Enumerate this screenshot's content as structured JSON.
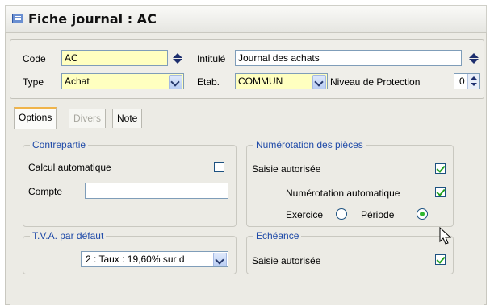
{
  "window": {
    "title": "Fiche journal : AC"
  },
  "header": {
    "code_label": "Code",
    "code_value": "AC",
    "intitule_label": "Intitulé",
    "intitule_value": "Journal des achats",
    "type_label": "Type",
    "type_value": "Achat",
    "etab_label": "Etab.",
    "etab_value": "COMMUN",
    "niveau_label": "Niveau de Protection",
    "niveau_value": "0"
  },
  "tabs": [
    {
      "label": "Options",
      "active": true
    },
    {
      "label": "Divers",
      "disabled": true
    },
    {
      "label": "Note"
    }
  ],
  "contrepartie": {
    "title": "Contrepartie",
    "calcul_label": "Calcul automatique",
    "calcul_checked": false,
    "compte_label": "Compte",
    "compte_value": ""
  },
  "numerotation": {
    "title": "Numérotation des pièces",
    "saisie_label": "Saisie autorisée",
    "saisie_checked": true,
    "auto_label": "Numérotation automatique",
    "auto_checked": true,
    "exercice_label": "Exercice",
    "periode_label": "Période",
    "selected": "Période"
  },
  "tva": {
    "title": "T.V.A. par défaut",
    "value": "2 : Taux : 19,60% sur d"
  },
  "echeance": {
    "title": "Echéance",
    "saisie_label": "Saisie autorisée",
    "saisie_checked": true
  },
  "colors": {
    "required_field": "#ffffc0",
    "group_title": "#1f4aa8",
    "check": "#21a121"
  }
}
